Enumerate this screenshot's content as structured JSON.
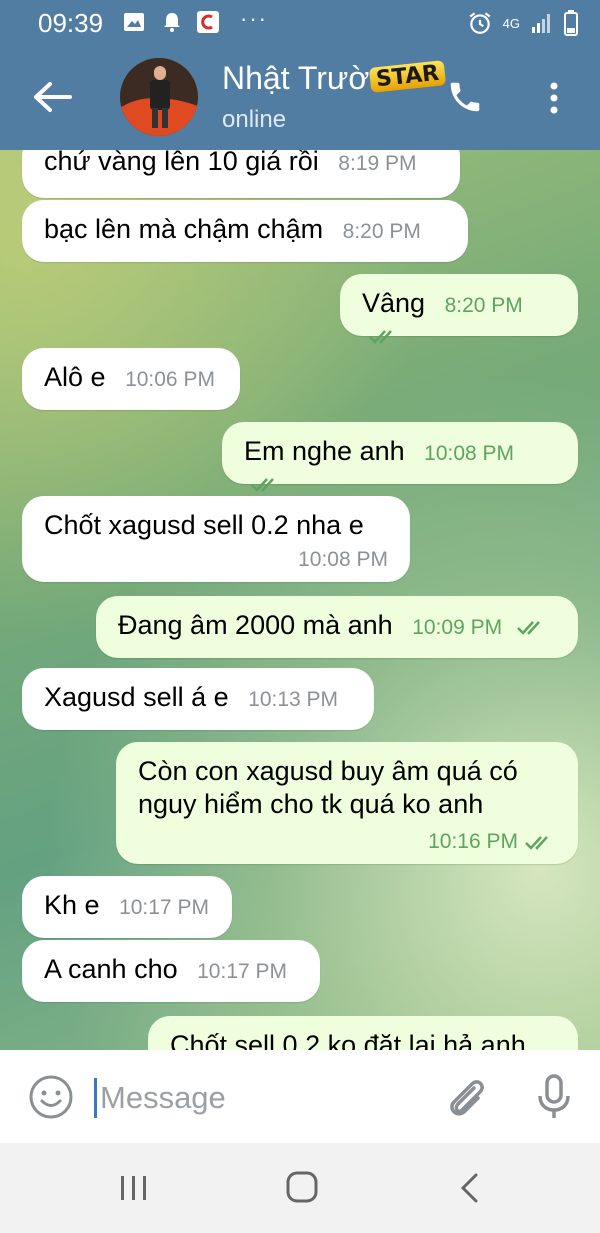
{
  "status_bar": {
    "time": "09:39",
    "network": "4G"
  },
  "header": {
    "title": "Nhật Trườ",
    "badge": "STAR",
    "status": "online"
  },
  "messages": [
    {
      "dir": "in",
      "text": "chứ vàng lên 10 giá rồi",
      "time": "8:19 PM"
    },
    {
      "dir": "in",
      "text": "bạc lên mà chậm chậm",
      "time": "8:20 PM"
    },
    {
      "dir": "out",
      "text": "Vâng",
      "time": "8:20 PM"
    },
    {
      "dir": "in",
      "text": "Alô e",
      "time": "10:06 PM"
    },
    {
      "dir": "out",
      "text": "Em nghe anh",
      "time": "10:08 PM"
    },
    {
      "dir": "in",
      "text": "Chốt xagusd sell 0.2 nha e",
      "time": "10:08 PM"
    },
    {
      "dir": "out",
      "text": "Đang âm 2000 mà anh",
      "time": "10:09 PM"
    },
    {
      "dir": "in",
      "text": "Xagusd sell á e",
      "time": "10:13 PM"
    },
    {
      "dir": "out",
      "text_line1": "Còn con xagusd buy âm quá có",
      "text_line2": "nguy hiểm cho tk quá ko anh",
      "time": "10:16 PM"
    },
    {
      "dir": "in",
      "text": "Kh e",
      "time": "10:17 PM"
    },
    {
      "dir": "in",
      "text": "A canh cho",
      "time": "10:17 PM"
    },
    {
      "dir": "out",
      "text": "Chốt sell 0.2 ko đặt lại hả anh"
    }
  ],
  "composer": {
    "placeholder": "Message"
  },
  "colors": {
    "header": "#517da2",
    "outgoing_bubble": "#effedd",
    "incoming_bubble": "#ffffff",
    "read_check": "#5ea460"
  }
}
